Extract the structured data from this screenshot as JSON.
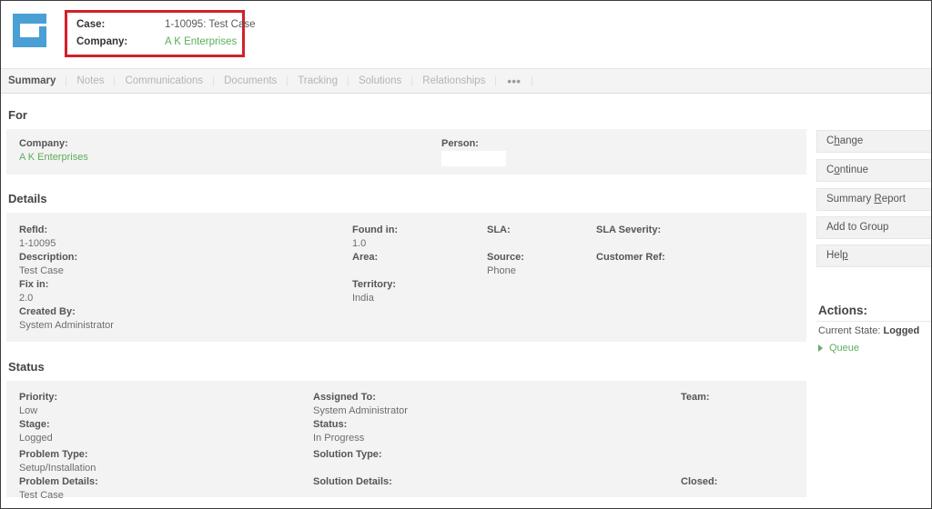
{
  "header": {
    "app_icon": "folder-icon",
    "icon_color": "#4a9fd5",
    "highlight_color": "#d2202a",
    "case_label": "Case:",
    "case_value": "1-10095: Test Case",
    "company_label": "Company:",
    "company_value": "A K Enterprises",
    "link_color": "#5bae5b"
  },
  "tabs": [
    {
      "label": "Summary",
      "active": true
    },
    {
      "label": "Notes",
      "active": false
    },
    {
      "label": "Communications",
      "active": false
    },
    {
      "label": "Documents",
      "active": false
    },
    {
      "label": "Tracking",
      "active": false
    },
    {
      "label": "Solutions",
      "active": false
    },
    {
      "label": "Relationships",
      "active": false
    }
  ],
  "more_tab_label": "•••",
  "sections": {
    "for": {
      "title": "For",
      "company_label": "Company:",
      "company_value": "A K Enterprises",
      "person_label": "Person:",
      "person_value": ""
    },
    "details": {
      "title": "Details",
      "refid_label": "RefId:",
      "refid_value": "1-10095",
      "description_label": "Description:",
      "description_value": "Test Case",
      "fixin_label": "Fix in:",
      "fixin_value": "2.0",
      "createdby_label": "Created By:",
      "createdby_value": "System Administrator",
      "foundin_label": "Found in:",
      "foundin_value": "1.0",
      "area_label": "Area:",
      "area_value": "",
      "territory_label": "Territory:",
      "territory_value": "India",
      "sla_label": "SLA:",
      "sla_value": "",
      "source_label": "Source:",
      "source_value": "Phone",
      "sla_severity_label": "SLA Severity:",
      "sla_severity_value": "",
      "customer_ref_label": "Customer Ref:",
      "customer_ref_value": ""
    },
    "status": {
      "title": "Status",
      "priority_label": "Priority:",
      "priority_value": "Low",
      "stage_label": "Stage:",
      "stage_value": "Logged",
      "problem_type_label": "Problem Type:",
      "problem_type_value": "Setup/Installation",
      "problem_details_label": "Problem Details:",
      "problem_details_value": "Test Case",
      "assigned_to_label": "Assigned To:",
      "assigned_to_value": "System Administrator",
      "status_label": "Status:",
      "status_value": "In Progress",
      "solution_type_label": "Solution Type:",
      "solution_type_value": "",
      "solution_details_label": "Solution Details:",
      "solution_details_value": "",
      "team_label": "Team:",
      "team_value": "",
      "closed_label": "Closed:",
      "closed_value": ""
    }
  },
  "sidebar": {
    "buttons": [
      {
        "prefix": "C",
        "key": "h",
        "suffix": "ange"
      },
      {
        "prefix": "C",
        "key": "o",
        "suffix": "ntinue"
      },
      {
        "prefix": "Summary ",
        "key": "R",
        "suffix": "eport"
      },
      {
        "prefix": "Add to Group",
        "key": "",
        "suffix": ""
      },
      {
        "prefix": "Hel",
        "key": "p",
        "suffix": ""
      }
    ],
    "actions_title": "Actions:",
    "current_state_label": "Current State:",
    "current_state_value": "Logged",
    "queue_label": "Queue"
  }
}
